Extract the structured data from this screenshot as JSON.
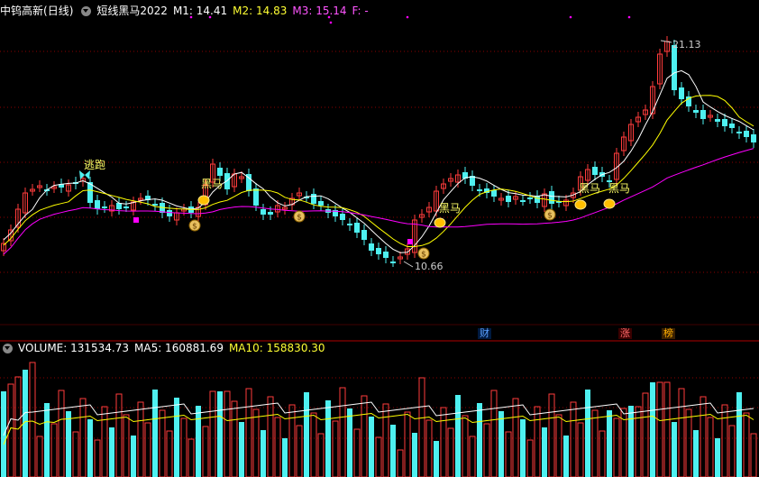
{
  "main": {
    "stock_name": "中钨高新",
    "period": "(日线)",
    "indicator": "短线黑马2022",
    "m1": "M1: 14.41",
    "m2": "M2: 14.83",
    "m3": "M3: 15.14",
    "f": "F: -",
    "high_label": "21.13",
    "low_label": "10.66",
    "escape_label": "逃跑",
    "black_horse_label": "黑马"
  },
  "volume": {
    "label": "VOLUME: 131534.73",
    "ma5": "MA5: 160881.69",
    "ma10": "MA10: 158830.30"
  },
  "event_tags": [
    "财",
    "涨",
    "榜"
  ],
  "colors": {
    "background": "#000000",
    "up": "#ff3c3c",
    "down": "#4ef0f0",
    "ma_white": "#ffffff",
    "ma_yellow": "#ffff00",
    "ma_magenta": "#ff00ff",
    "grid": "#8b0000"
  }
}
